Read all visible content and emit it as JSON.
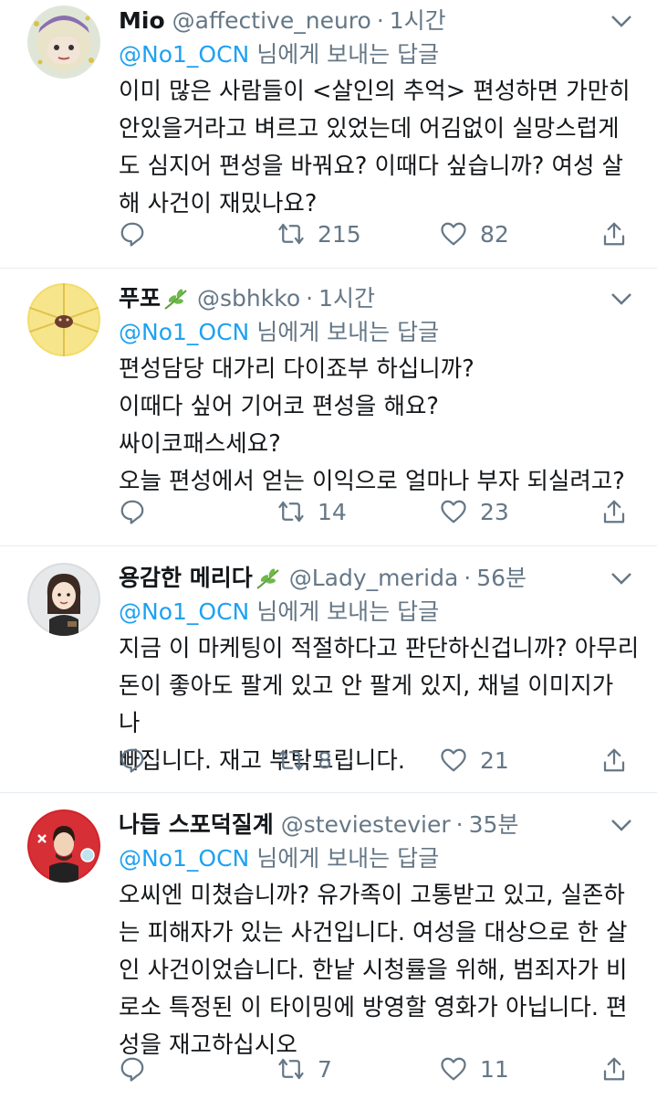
{
  "reply_prefix_to": "@No1_OCN",
  "reply_prefix_suffix": " 님에게 보내는 답글",
  "tweets": [
    {
      "name": "Mio",
      "handle": "@affective_neuro",
      "sep": "·",
      "time": "1시간",
      "body": "이미 많은 사람들이 <살인의 추억> 편성하면 가만히\n안있을거라고 벼르고 있었는데 어김없이 실망스럽게\n도 심지어 편성을 바꿔요? 이때다 싶습니까? 여성 살\n해 사건이 재밌나요?",
      "retweets": "215",
      "likes": "82"
    },
    {
      "name": "푸포",
      "handle": "@sbhkko",
      "sep": "·",
      "time": "1시간",
      "body": "편성담당 대가리 다이죠부 하십니까?\n이때다 싶어 기어코 편성을 해요?\n싸이코패스세요?\n오늘 편성에서 얻는 이익으로 얼마나 부자 되실려고?",
      "retweets": "14",
      "likes": "23"
    },
    {
      "name": "용감한 메리다",
      "handle": "@Lady_merida",
      "sep": "·",
      "time": "56분",
      "body": "지금 이 마케팅이 적절하다고 판단하신겁니까? 아무리\n돈이 좋아도 팔게 있고 안 팔게 있지, 채널 이미지가 나\n빠집니다. 재고 부탁드립니다.",
      "retweets": "8",
      "likes": "21"
    },
    {
      "name": "나듭 스포덕질계",
      "handle": "@steviestevier",
      "sep": "·",
      "time": "35분",
      "body": "오씨엔 미쳤습니까? 유가족이 고통받고 있고, 실존하\n는 피해자가 있는 사건입니다. 여성을 대상으로 한 살\n인 사건이었습니다. 한낱 시청률을 위해, 범죄자가 비\n로소 특정된 이 타이밍에 방영할 영화가 아닙니다. 편\n성을 재고하십시오",
      "retweets": "7",
      "likes": "11"
    }
  ],
  "icons": {
    "reply": "reply-icon",
    "retweet": "retweet-icon",
    "like": "heart-icon",
    "share": "share-icon",
    "more": "chevron-down-icon",
    "leaf": "leaf-icon"
  },
  "colors": {
    "link": "#1da1f2",
    "secondary": "#657786",
    "text": "#14171a",
    "divider": "#e6ecf0",
    "leaf": "#5a9e3a"
  }
}
